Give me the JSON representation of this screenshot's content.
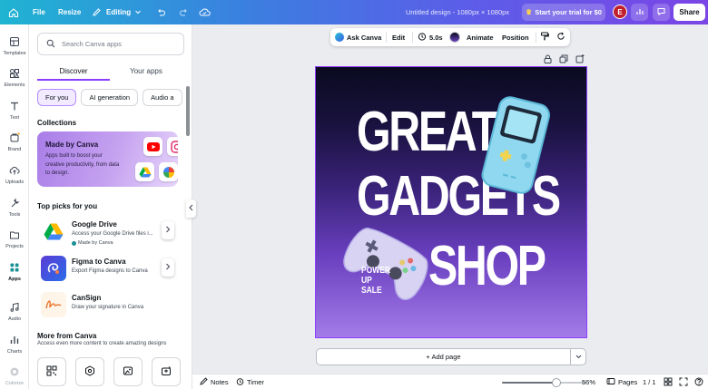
{
  "topbar": {
    "file_label": "File",
    "resize_label": "Resize",
    "editing_label": "Editing",
    "doc_title": "Untitled design - 1080px × 1080px",
    "trial_label": "Start your trial for $0",
    "avatar_initial": "E",
    "share_label": "Share"
  },
  "rail": {
    "items": [
      {
        "label": "Templates",
        "icon": "templates-icon"
      },
      {
        "label": "Elements",
        "icon": "elements-icon"
      },
      {
        "label": "Text",
        "icon": "text-icon"
      },
      {
        "label": "Brand",
        "icon": "brand-icon"
      },
      {
        "label": "Uploads",
        "icon": "uploads-icon"
      },
      {
        "label": "Tools",
        "icon": "tools-icon"
      },
      {
        "label": "Projects",
        "icon": "projects-icon"
      },
      {
        "label": "Apps",
        "icon": "apps-icon"
      },
      {
        "label": "Audio",
        "icon": "audio-icon"
      },
      {
        "label": "Charts",
        "icon": "charts-icon"
      },
      {
        "label": "Colorize",
        "icon": "colorize-icon"
      }
    ]
  },
  "panel": {
    "search_placeholder": "Search Canva apps",
    "tabs": [
      "Discover",
      "Your apps"
    ],
    "chips": [
      "For you",
      "AI generation",
      "Audio a"
    ],
    "collections_title": "Collections",
    "collection": {
      "title": "Made by Canva",
      "desc": "Apps built to boost your creative productivity, from data to design."
    },
    "top_picks_title": "Top picks for you",
    "apps": [
      {
        "name": "Google Drive",
        "desc": "Access your Google Drive files i...",
        "badge": "Made by Canva"
      },
      {
        "name": "Figma to Canva",
        "desc": "Export Figma designs to Canva"
      },
      {
        "name": "CanSign",
        "desc": "Draw your signature in Canva"
      }
    ],
    "more_title": "More from Canva",
    "more_desc": "Access even more content to create amazing designs"
  },
  "context_toolbar": {
    "ask_label": "Ask Canva",
    "edit_label": "Edit",
    "duration_label": "5.0s",
    "animate_label": "Animate",
    "position_label": "Position"
  },
  "design": {
    "line1": "GREAT",
    "line2": "GADGETS",
    "line3": "SHOP",
    "promo1": "POWER",
    "promo2": "UP",
    "promo3": "SALE"
  },
  "add_page_label": "+ Add page",
  "bottombar": {
    "notes_label": "Notes",
    "timer_label": "Timer",
    "zoom_percent": 56,
    "zoom_label": "56%",
    "pages_label": "Pages",
    "page_count": "1 / 1"
  },
  "colors": {
    "accent": "#8b3dff",
    "topbar_start": "#1fb4d2",
    "topbar_end": "#7b45e6"
  }
}
